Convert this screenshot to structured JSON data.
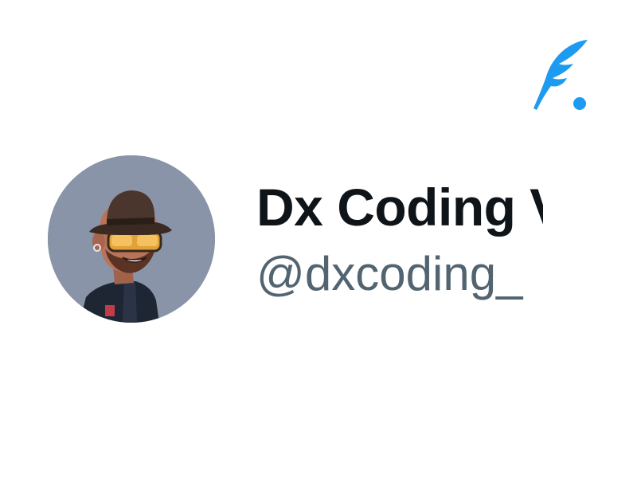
{
  "profile": {
    "display_name": "Dx Coding Vibes",
    "handle": "@dxcoding_",
    "avatar_description": "cartoon avatar"
  },
  "brand": {
    "icon": "quill-feather-logo",
    "accent_color": "#1d9bf0"
  },
  "colors": {
    "name_text": "#0f1419",
    "handle_text": "#536471",
    "avatar_background": "#8a94a8"
  }
}
